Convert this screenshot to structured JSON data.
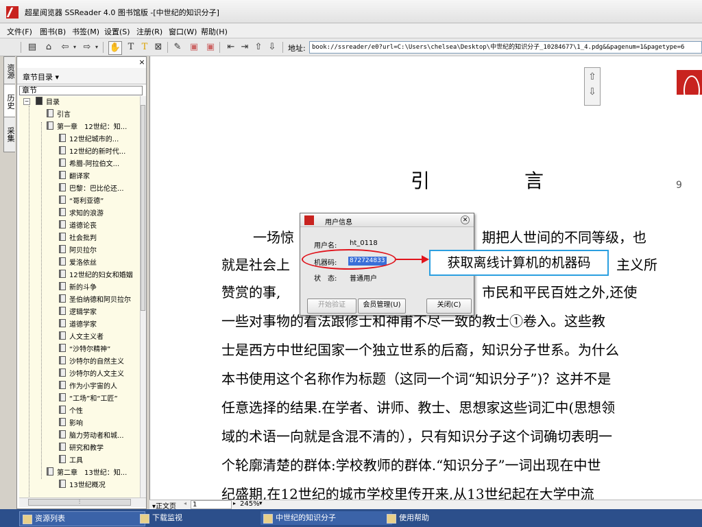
{
  "window": {
    "title": "超星阅览器 SSReader 4.0 图书馆版 -[中世纪的知识分子]"
  },
  "menu": [
    "文件(F)",
    "图书(B)",
    "书签(M)",
    "设置(S)",
    "注册(R)",
    "窗口(W)",
    "帮助(H)"
  ],
  "toolbar": {
    "address_label": "地址:",
    "address_value": "book://ssreader/e0?url=C:\\Users\\chelsea\\Desktop\\中世纪的知识分子_10284677\\1_4.pdg&&pagenum=1&pagetype=6"
  },
  "side_tabs": [
    "资源",
    "历史",
    "采集"
  ],
  "panel": {
    "close": "×",
    "dropdown": "章节目录 ▾",
    "tab": "章节"
  },
  "tree": [
    "目录",
    "引言",
    "第一章　12世纪：知...",
    "12世纪城市的...",
    "12世纪的新时代...",
    "希腊-阿拉伯文...",
    "翻译家",
    "巴黎：巴比伦还...",
    "“哥利亚德”",
    "求知的浪游",
    "道德论丧",
    "社会批判",
    "阿贝拉尔",
    "爱洛依丝",
    "12世纪的妇女和婚姻",
    "新的斗争",
    "圣伯纳德和阿贝拉尔",
    "逻辑学家",
    "道德学家",
    "人文主义者",
    "“沙特尔精神”",
    "沙特尔的自然主义",
    "沙特尔的人文主义",
    "作为小宇宙的人",
    "“工场”和“工匠”",
    "个性",
    "影响",
    "脑力劳动者和城...",
    "研究和教学",
    "工具",
    "第二章　13世纪：知...",
    "13世纪概况"
  ],
  "document": {
    "heading": "引　言",
    "page_number": "9",
    "lines": [
      "一场惊",
      "就是社会上",
      "赞赏的事,",
      "一些对事物的看法跟修士和神甫不尽一致的教士①卷入。这些教",
      "士是西方中世纪国家一个独立世系的后裔，知识分子世系。为什么",
      "本书使用这个名称作为标题（这同一个词“知识分子”)？这并不是",
      "任意选择的结果.在学者、讲师、教士、思想家这些词汇中(思想领",
      "域的术语一向就是含混不清的），只有知识分子这个词确切表明一",
      "个轮廓清楚的群体:学校教师的群体.“知识分子”一词出现在中世",
      "纪盛期,在12世纪的城市学校里传开来,从13世纪起在大学中流"
    ],
    "line1_tail": "期把人世间的不同等级，也",
    "line2_tail": "主义所",
    "line3_tail": "市民和平民百姓之外,还使"
  },
  "dialog": {
    "title": "用户信息",
    "username_label": "用户名:",
    "username_value": "ht_0118",
    "machine_label": "机器码:",
    "machine_value": "872724833",
    "status_label": "状　态:",
    "status_value": "普通用户",
    "btn_verify": "开始验证",
    "btn_member": "会员管理(U)",
    "btn_close": "关闭(C)"
  },
  "annotation": "获取离线计算机的机器码",
  "doc_status": {
    "mode": "▾正文页",
    "page": "1",
    "zoom": "245%"
  },
  "taskbar": [
    "资源列表",
    "下载监视",
    "中世纪的知识分子",
    "使用帮助"
  ],
  "colors": {
    "accent_red": "#e0141c",
    "annotation_border": "#2a9fe0",
    "taskbar": "#2c4f8b",
    "tree_bg": "#fdfbe6"
  }
}
